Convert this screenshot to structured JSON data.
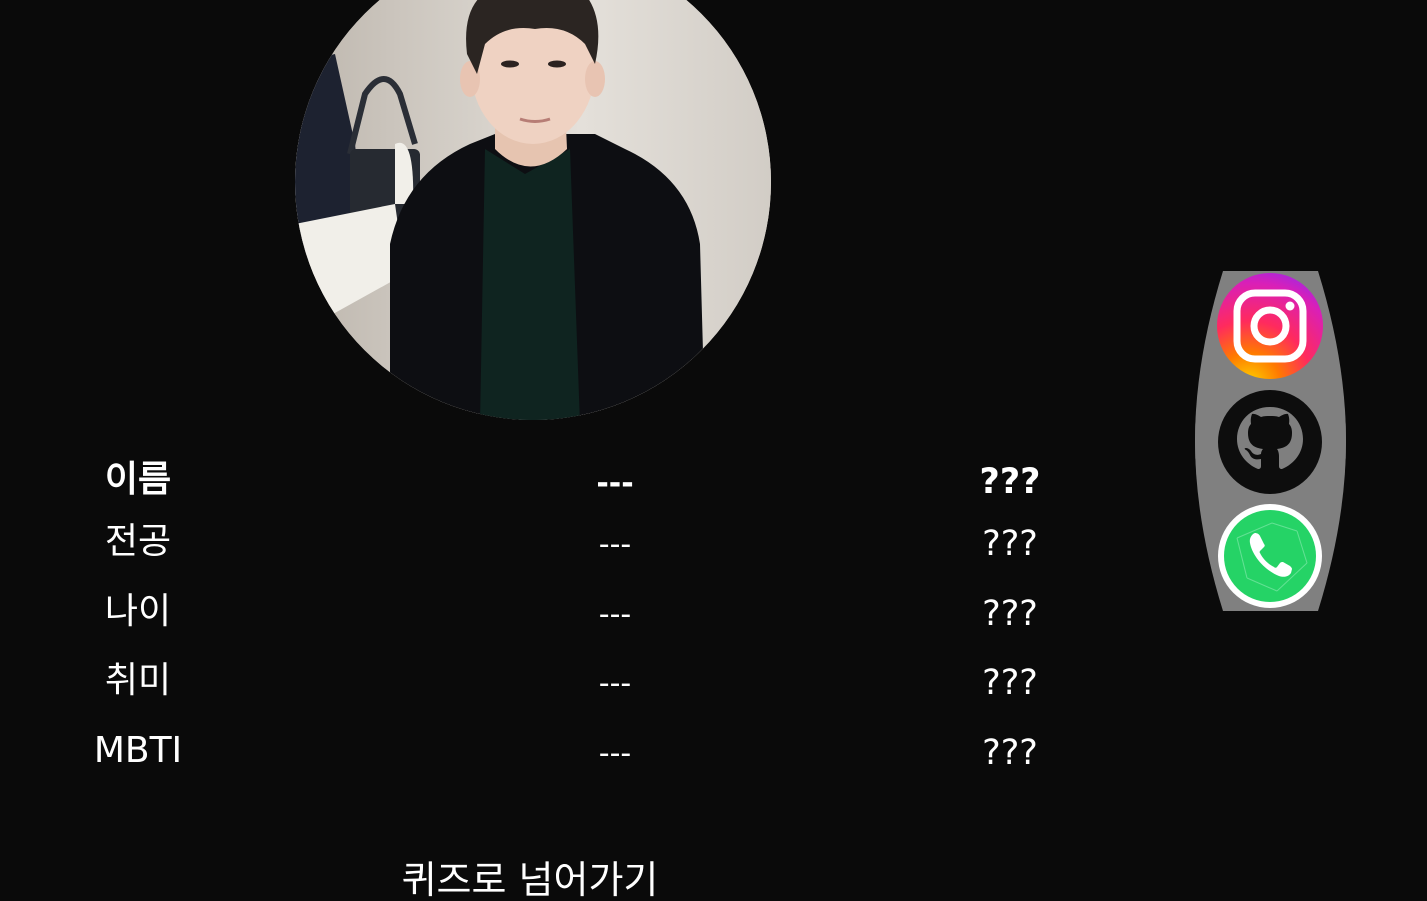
{
  "profile": {
    "photo_alt": "profile photo"
  },
  "info": {
    "rows": [
      {
        "label": "이름",
        "value": "---",
        "answer": "???"
      },
      {
        "label": "전공",
        "value": "---",
        "answer": "???"
      },
      {
        "label": "나이",
        "value": "---",
        "answer": "???"
      },
      {
        "label": "취미",
        "value": "---",
        "answer": "???"
      },
      {
        "label": "MBTI",
        "value": "---",
        "answer": "???"
      }
    ]
  },
  "social": {
    "icons": [
      "instagram-icon",
      "github-icon",
      "whatsapp-phone-icon"
    ],
    "panel_color": "#808080"
  },
  "quiz": {
    "link_label": "퀴즈로 넘어가기"
  },
  "colors": {
    "background": "#0a0a0a",
    "text": "#ffffff",
    "phone_green": "#25d366"
  }
}
